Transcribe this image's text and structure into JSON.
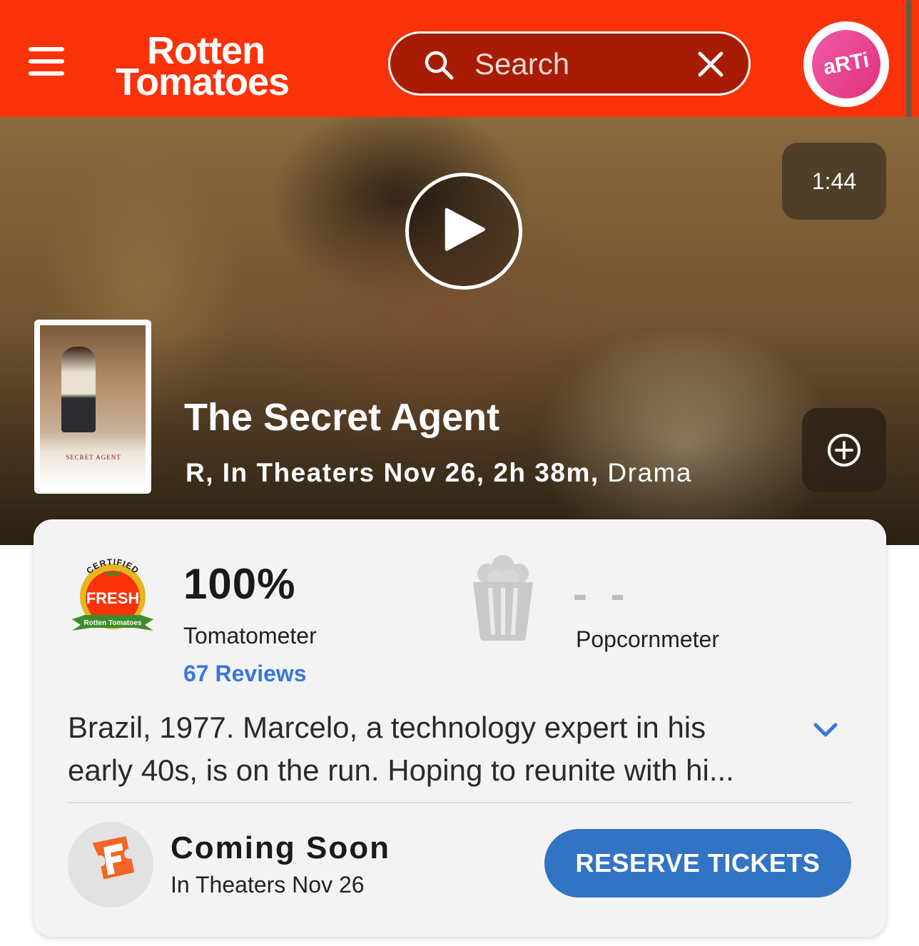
{
  "header": {
    "logo_line1": "Rotten",
    "logo_line2": "Tomatoes",
    "search_placeholder": "Search",
    "avatar_text": "aRTi",
    "brand_color": "#fa320a"
  },
  "hero": {
    "duration": "1:44",
    "poster_title": "SECRET AGENT",
    "title": "The Secret Agent",
    "meta_main": "R, In Theaters Nov 26, 2h 38m, ",
    "meta_genre": "Drama"
  },
  "scores": {
    "badge_top": "CERTIFIED",
    "badge_mid": "FRESH",
    "badge_bottom": "Rotten Tomatoes",
    "tomatometer_value": "100%",
    "tomatometer_label": "Tomatometer",
    "reviews_link": "67 Reviews",
    "popcornmeter_value": "- -",
    "popcornmeter_label": "Popcornmeter"
  },
  "synopsis": {
    "line1": "Brazil, 1977. Marcelo, a technology expert in his",
    "line2": "early 40s, is on the run. Hoping to reunite with hi..."
  },
  "tickets": {
    "title": "Coming Soon",
    "subtitle": "In Theaters Nov 26",
    "button_label": "RESERVE TICKETS",
    "button_color": "#3373c4"
  }
}
